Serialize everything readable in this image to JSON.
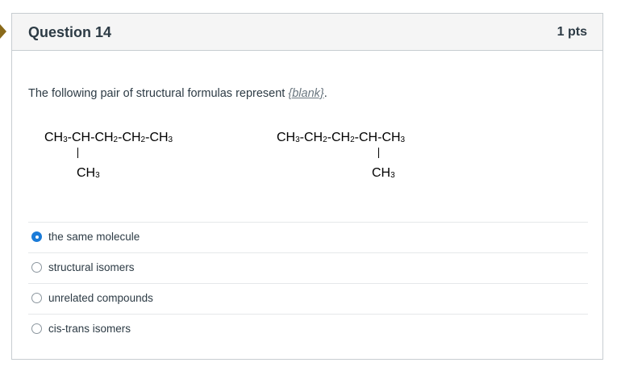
{
  "question": {
    "title": "Question 14",
    "points": "1 pts",
    "prompt_text": "The following pair of structural formulas represent ",
    "blank_text": "{blank}",
    "prompt_end": "."
  },
  "formulas": [
    {
      "segments": [
        "CH",
        "3",
        "-",
        "CH",
        "-CH",
        "2",
        "-CH",
        "2",
        "-CH",
        "3"
      ],
      "branch": [
        "CH",
        "3"
      ]
    },
    {
      "segments": [
        "CH",
        "3",
        "-CH",
        "2",
        "-CH",
        "2",
        "-",
        "CH",
        "-CH",
        "3"
      ],
      "branch": [
        "CH",
        "3"
      ]
    }
  ],
  "options": [
    {
      "label": "the same molecule",
      "selected": true
    },
    {
      "label": "structural isomers",
      "selected": false
    },
    {
      "label": "unrelated compounds",
      "selected": false
    },
    {
      "label": "cis-trans isomers",
      "selected": false
    }
  ],
  "colors": {
    "accent": "#1a7bd8",
    "header_bg": "#f5f5f5",
    "border": "#c7cdd1",
    "text": "#2d3b45"
  }
}
